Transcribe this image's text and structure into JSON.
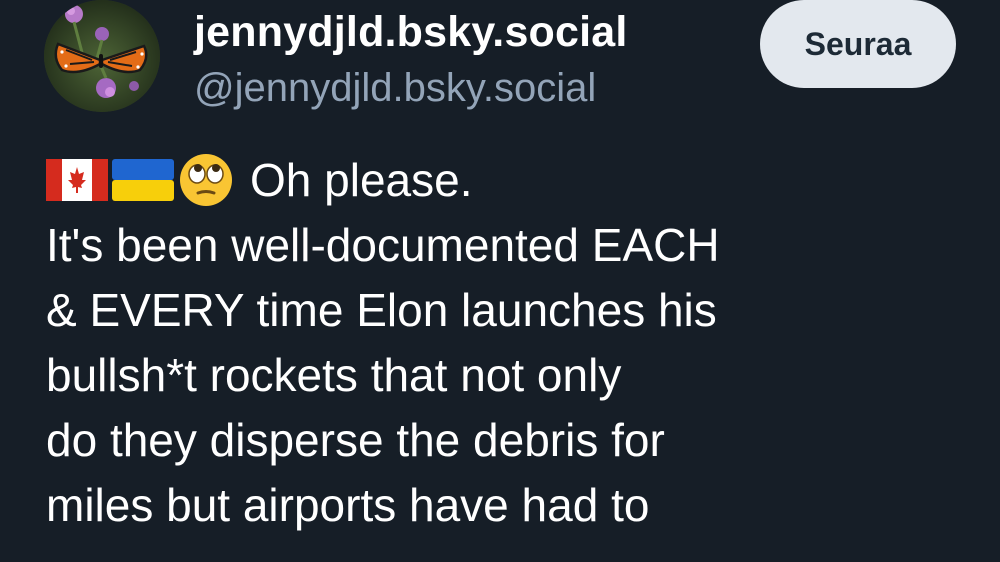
{
  "profile": {
    "display_name": "jennydjld.bsky.social",
    "handle": "@jennydjld.bsky.social",
    "avatar_icon": "monarch-butterfly-avatar"
  },
  "actions": {
    "follow_label": "Seuraa"
  },
  "post": {
    "emojis": [
      "canada-flag-icon",
      "ukraine-flag-icon",
      "face-with-rolling-eyes-icon"
    ],
    "lines": [
      "Oh please.",
      "It's been well-documented EACH",
      "& EVERY time Elon launches his",
      "bullsh*t rockets that not only",
      "do they disperse the debris for",
      "miles but airports have had to"
    ]
  },
  "colors": {
    "background": "#161e27",
    "handle": "#93a4b8",
    "follow_button_bg": "#e3e8ee",
    "follow_button_text": "#1d2a36"
  }
}
